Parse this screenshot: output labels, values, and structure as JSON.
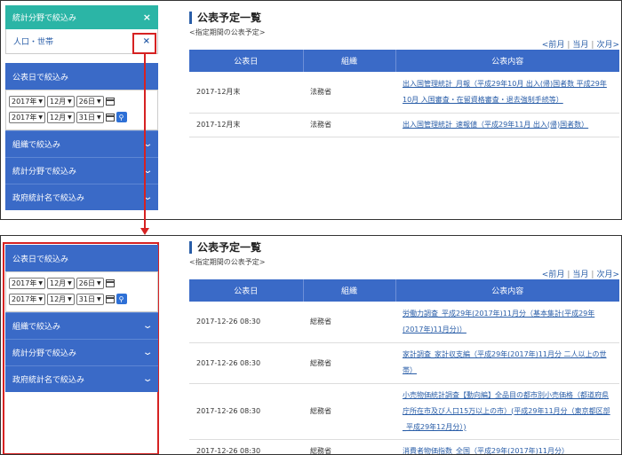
{
  "top": {
    "field_label": "統計分野で絞込み",
    "field_close": "×",
    "selected": "人口・世帯",
    "selected_close": "×",
    "date_header": "公表日で絞込み",
    "date_from": {
      "year": "2017年",
      "month": "12月",
      "day": "26日"
    },
    "date_to": {
      "year": "2017年",
      "month": "12月",
      "day": "31日"
    },
    "accordions": [
      "組織で絞込み",
      "統計分野で絞込み",
      "政府統計名で絞込み"
    ],
    "title": "公表予定一覧",
    "subtitle": "<指定期間の公表予定>",
    "pager": [
      "<前月",
      "当月",
      "次月>"
    ],
    "headers": [
      "公表日",
      "組織",
      "公表内容"
    ],
    "rows": [
      {
        "date": "2017-12月末",
        "org": "法務省",
        "content": "出入国管理統計_月報（平成29年10月 出入(帰)国者数 平成29年10月 入国審査・在留資格審査・退去強制手続等）"
      },
      {
        "date": "2017-12月末",
        "org": "法務省",
        "content": "出入国管理統計_速報値（平成29年11月 出入(帰)国者数）"
      }
    ]
  },
  "bottom": {
    "date_header": "公表日で絞込み",
    "date_from": {
      "year": "2017年",
      "month": "12月",
      "day": "26日"
    },
    "date_to": {
      "year": "2017年",
      "month": "12月",
      "day": "31日"
    },
    "accordions": [
      "組織で絞込み",
      "統計分野で絞込み",
      "政府統計名で絞込み"
    ],
    "title": "公表予定一覧",
    "subtitle": "<指定期間の公表予定>",
    "pager": [
      "<前月",
      "当月",
      "次月>"
    ],
    "headers": [
      "公表日",
      "組織",
      "公表内容"
    ],
    "rows": [
      {
        "date": "2017-12-26 08:30",
        "org": "総務省",
        "content": "労働力調査_平成29年(2017年)11月分（基本集計(平成29年(2017年)11月分)）"
      },
      {
        "date": "2017-12-26 08:30",
        "org": "総務省",
        "content": "家計調査_家計収支編（平成29年(2017年)11月分 二人以上の世帯）"
      },
      {
        "date": "2017-12-26 08:30",
        "org": "総務省",
        "content": "小売物価統計調査【動向編】全品目の都市別小売価格（都道府県庁所在市及び人口15万以上の市）(平成29年11月分（東京都区部_平成29年12月分）)"
      },
      {
        "date": "2017-12-26 08:30",
        "org": "総務省",
        "content": "消費者物価指数_全国（平成29年(2017年)11月分）"
      }
    ]
  }
}
